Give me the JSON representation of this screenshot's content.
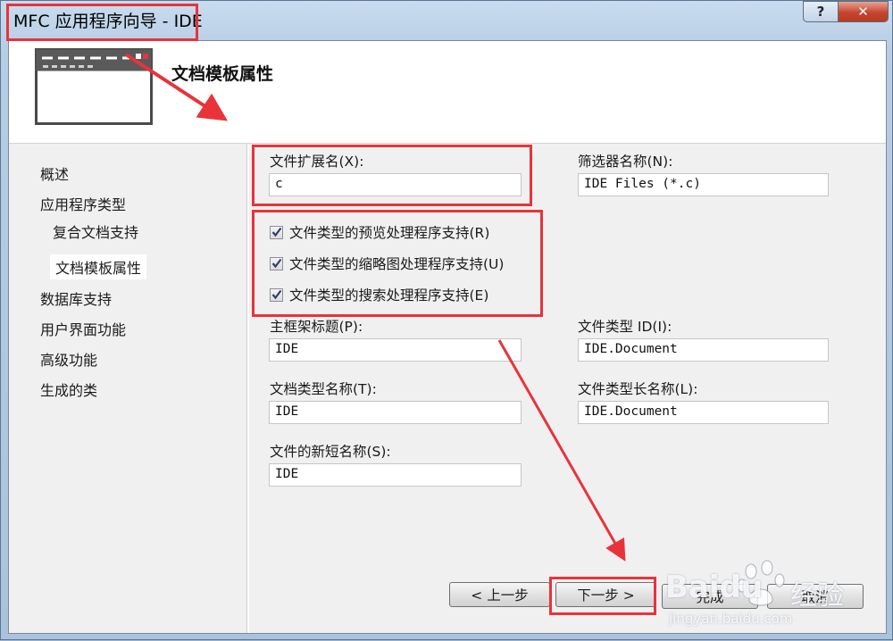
{
  "window": {
    "title": "MFC 应用程序向导 - IDE",
    "help_label": "?",
    "close_label": "✕"
  },
  "header": {
    "title": "文档模板属性",
    "icon": "window-template-icon"
  },
  "nav": {
    "items": [
      {
        "label": "概述"
      },
      {
        "label": "应用程序类型"
      },
      {
        "label": "复合文档支持"
      },
      {
        "label": "文档模板属性"
      },
      {
        "label": "数据库支持"
      },
      {
        "label": "用户界面功能"
      },
      {
        "label": "高级功能"
      },
      {
        "label": "生成的类"
      }
    ],
    "selected_index": 3
  },
  "form": {
    "ext_label": "文件扩展名(X):",
    "ext_value": "c",
    "filter_label": "筛选器名称(N):",
    "filter_value": "IDE Files (*.c)",
    "checkboxes": [
      {
        "label": "文件类型的预览处理程序支持(R)",
        "checked": true
      },
      {
        "label": "文件类型的缩略图处理程序支持(U)",
        "checked": true
      },
      {
        "label": "文件类型的搜索处理程序支持(E)",
        "checked": true
      }
    ],
    "main_frame_label": "主框架标题(P):",
    "main_frame_value": "IDE",
    "filetype_id_label": "文件类型 ID(I):",
    "filetype_id_value": "IDE.Document",
    "doctype_name_label": "文档类型名称(T):",
    "doctype_name_value": "IDE",
    "filetype_long_label": "文件类型长名称(L):",
    "filetype_long_value": "IDE.Document",
    "short_name_label": "文件的新短名称(S):",
    "short_name_value": "IDE"
  },
  "buttons": {
    "prev": "< 上一步",
    "next": "下一步 >",
    "finish": "完成",
    "cancel": "取消"
  },
  "watermark": {
    "brand": "Baidu",
    "cn": "经验",
    "url": "jingyan.baidu.com"
  },
  "colors": {
    "annotation": "#e8333b",
    "titlebar": "#b7cde4",
    "close": "#c7452f"
  }
}
